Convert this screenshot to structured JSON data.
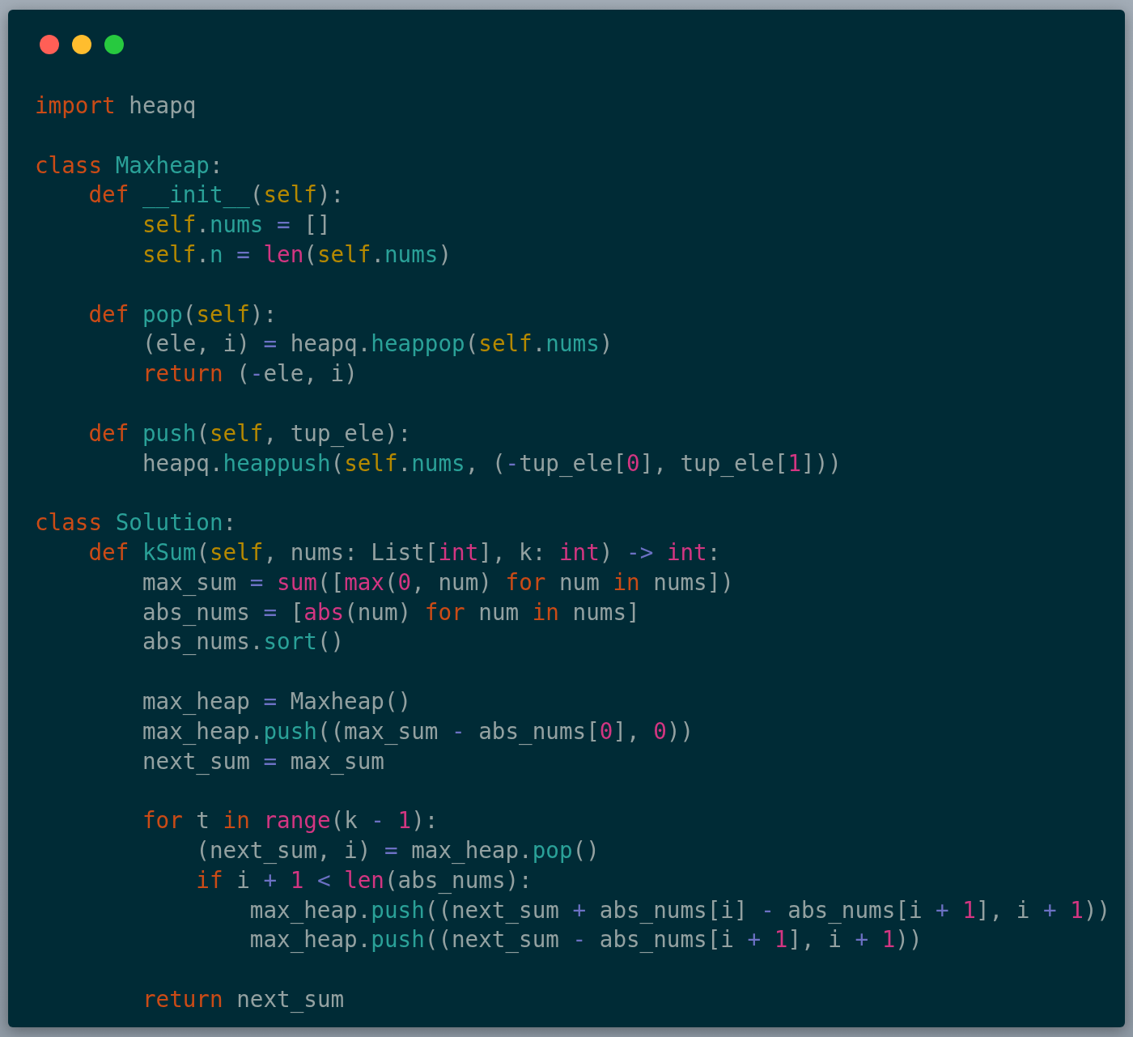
{
  "code_blocks": [
    [
      [
        {
          "kind": "keyword",
          "text": "import"
        },
        {
          "kind": "plain",
          "text": " heapq"
        }
      ]
    ],
    [
      [
        {
          "kind": "keyword",
          "text": "class"
        },
        {
          "kind": "name",
          "text": " Maxheap"
        },
        {
          "kind": "plain",
          "text": ":"
        }
      ],
      [
        {
          "kind": "keyword",
          "text": "    def"
        },
        {
          "kind": "name",
          "text": " __init__"
        },
        {
          "kind": "plain",
          "text": "("
        },
        {
          "kind": "self",
          "text": "self"
        },
        {
          "kind": "plain",
          "text": "):"
        }
      ],
      [
        {
          "kind": "self",
          "text": "        self"
        },
        {
          "kind": "plain",
          "text": "."
        },
        {
          "kind": "name",
          "text": "nums"
        },
        {
          "kind": "operator",
          "text": " ="
        },
        {
          "kind": "plain",
          "text": " []"
        }
      ],
      [
        {
          "kind": "self",
          "text": "        self"
        },
        {
          "kind": "plain",
          "text": "."
        },
        {
          "kind": "name",
          "text": "n"
        },
        {
          "kind": "operator",
          "text": " ="
        },
        {
          "kind": "builtin",
          "text": " len"
        },
        {
          "kind": "plain",
          "text": "("
        },
        {
          "kind": "self",
          "text": "self"
        },
        {
          "kind": "plain",
          "text": "."
        },
        {
          "kind": "name",
          "text": "nums"
        },
        {
          "kind": "plain",
          "text": ")"
        }
      ]
    ],
    [
      [
        {
          "kind": "keyword",
          "text": "    def"
        },
        {
          "kind": "name",
          "text": " pop"
        },
        {
          "kind": "plain",
          "text": "("
        },
        {
          "kind": "self",
          "text": "self"
        },
        {
          "kind": "plain",
          "text": "):"
        }
      ],
      [
        {
          "kind": "plain",
          "text": "        (ele, i) "
        },
        {
          "kind": "operator",
          "text": "="
        },
        {
          "kind": "plain",
          "text": " heapq."
        },
        {
          "kind": "name",
          "text": "heappop"
        },
        {
          "kind": "plain",
          "text": "("
        },
        {
          "kind": "self",
          "text": "self"
        },
        {
          "kind": "plain",
          "text": "."
        },
        {
          "kind": "name",
          "text": "nums"
        },
        {
          "kind": "plain",
          "text": ")"
        }
      ],
      [
        {
          "kind": "keyword",
          "text": "        return"
        },
        {
          "kind": "plain",
          "text": " ("
        },
        {
          "kind": "operator",
          "text": "-"
        },
        {
          "kind": "plain",
          "text": "ele, i)"
        }
      ]
    ],
    [
      [
        {
          "kind": "keyword",
          "text": "    def"
        },
        {
          "kind": "name",
          "text": " push"
        },
        {
          "kind": "plain",
          "text": "("
        },
        {
          "kind": "self",
          "text": "self"
        },
        {
          "kind": "plain",
          "text": ", tup_ele):"
        }
      ],
      [
        {
          "kind": "plain",
          "text": "        heapq."
        },
        {
          "kind": "name",
          "text": "heappush"
        },
        {
          "kind": "plain",
          "text": "("
        },
        {
          "kind": "self",
          "text": "self"
        },
        {
          "kind": "plain",
          "text": "."
        },
        {
          "kind": "name",
          "text": "nums"
        },
        {
          "kind": "plain",
          "text": ", ("
        },
        {
          "kind": "operator",
          "text": "-"
        },
        {
          "kind": "plain",
          "text": "tup_ele["
        },
        {
          "kind": "number",
          "text": "0"
        },
        {
          "kind": "plain",
          "text": "], tup_ele["
        },
        {
          "kind": "number",
          "text": "1"
        },
        {
          "kind": "plain",
          "text": "]))"
        }
      ]
    ],
    [
      [
        {
          "kind": "keyword",
          "text": "class"
        },
        {
          "kind": "name",
          "text": " Solution"
        },
        {
          "kind": "plain",
          "text": ":"
        }
      ],
      [
        {
          "kind": "keyword",
          "text": "    def"
        },
        {
          "kind": "name",
          "text": " kSum"
        },
        {
          "kind": "plain",
          "text": "("
        },
        {
          "kind": "self",
          "text": "self"
        },
        {
          "kind": "plain",
          "text": ", nums: List["
        },
        {
          "kind": "builtin",
          "text": "int"
        },
        {
          "kind": "plain",
          "text": "], k: "
        },
        {
          "kind": "builtin",
          "text": "int"
        },
        {
          "kind": "plain",
          "text": ") "
        },
        {
          "kind": "operator",
          "text": "->"
        },
        {
          "kind": "builtin",
          "text": " int"
        },
        {
          "kind": "plain",
          "text": ":"
        }
      ],
      [
        {
          "kind": "plain",
          "text": "        max_sum "
        },
        {
          "kind": "operator",
          "text": "="
        },
        {
          "kind": "builtin",
          "text": " sum"
        },
        {
          "kind": "plain",
          "text": "(["
        },
        {
          "kind": "builtin",
          "text": "max"
        },
        {
          "kind": "plain",
          "text": "("
        },
        {
          "kind": "number",
          "text": "0"
        },
        {
          "kind": "plain",
          "text": ", num) "
        },
        {
          "kind": "keyword",
          "text": "for"
        },
        {
          "kind": "plain",
          "text": " num "
        },
        {
          "kind": "keyword",
          "text": "in"
        },
        {
          "kind": "plain",
          "text": " nums])"
        }
      ],
      [
        {
          "kind": "plain",
          "text": "        abs_nums "
        },
        {
          "kind": "operator",
          "text": "="
        },
        {
          "kind": "plain",
          "text": " ["
        },
        {
          "kind": "builtin",
          "text": "abs"
        },
        {
          "kind": "plain",
          "text": "(num) "
        },
        {
          "kind": "keyword",
          "text": "for"
        },
        {
          "kind": "plain",
          "text": " num "
        },
        {
          "kind": "keyword",
          "text": "in"
        },
        {
          "kind": "plain",
          "text": " nums]"
        }
      ],
      [
        {
          "kind": "plain",
          "text": "        abs_nums."
        },
        {
          "kind": "name",
          "text": "sort"
        },
        {
          "kind": "plain",
          "text": "()"
        }
      ]
    ],
    [
      [
        {
          "kind": "plain",
          "text": "        max_heap "
        },
        {
          "kind": "operator",
          "text": "="
        },
        {
          "kind": "plain",
          "text": " Maxheap()"
        }
      ],
      [
        {
          "kind": "plain",
          "text": "        max_heap."
        },
        {
          "kind": "name",
          "text": "push"
        },
        {
          "kind": "plain",
          "text": "((max_sum "
        },
        {
          "kind": "operator",
          "text": "-"
        },
        {
          "kind": "plain",
          "text": " abs_nums["
        },
        {
          "kind": "number",
          "text": "0"
        },
        {
          "kind": "plain",
          "text": "], "
        },
        {
          "kind": "number",
          "text": "0"
        },
        {
          "kind": "plain",
          "text": "))"
        }
      ],
      [
        {
          "kind": "plain",
          "text": "        next_sum "
        },
        {
          "kind": "operator",
          "text": "="
        },
        {
          "kind": "plain",
          "text": " max_sum"
        }
      ]
    ],
    [
      [
        {
          "kind": "keyword",
          "text": "        for"
        },
        {
          "kind": "plain",
          "text": " t "
        },
        {
          "kind": "keyword",
          "text": "in"
        },
        {
          "kind": "builtin",
          "text": " range"
        },
        {
          "kind": "plain",
          "text": "(k "
        },
        {
          "kind": "operator",
          "text": "-"
        },
        {
          "kind": "number",
          "text": " 1"
        },
        {
          "kind": "plain",
          "text": "):"
        }
      ],
      [
        {
          "kind": "plain",
          "text": "            (next_sum, i) "
        },
        {
          "kind": "operator",
          "text": "="
        },
        {
          "kind": "plain",
          "text": " max_heap."
        },
        {
          "kind": "name",
          "text": "pop"
        },
        {
          "kind": "plain",
          "text": "()"
        }
      ],
      [
        {
          "kind": "keyword",
          "text": "            if"
        },
        {
          "kind": "plain",
          "text": " i "
        },
        {
          "kind": "operator",
          "text": "+"
        },
        {
          "kind": "number",
          "text": " 1"
        },
        {
          "kind": "operator",
          "text": " <"
        },
        {
          "kind": "builtin",
          "text": " len"
        },
        {
          "kind": "plain",
          "text": "(abs_nums):"
        }
      ],
      [
        {
          "kind": "plain",
          "text": "                max_heap."
        },
        {
          "kind": "name",
          "text": "push"
        },
        {
          "kind": "plain",
          "text": "((next_sum "
        },
        {
          "kind": "operator",
          "text": "+"
        },
        {
          "kind": "plain",
          "text": " abs_nums[i] "
        },
        {
          "kind": "operator",
          "text": "-"
        },
        {
          "kind": "plain",
          "text": " abs_nums[i "
        },
        {
          "kind": "operator",
          "text": "+"
        },
        {
          "kind": "number",
          "text": " 1"
        },
        {
          "kind": "plain",
          "text": "], i "
        },
        {
          "kind": "operator",
          "text": "+"
        },
        {
          "kind": "number",
          "text": " 1"
        },
        {
          "kind": "plain",
          "text": "))"
        }
      ],
      [
        {
          "kind": "plain",
          "text": "                max_heap."
        },
        {
          "kind": "name",
          "text": "push"
        },
        {
          "kind": "plain",
          "text": "((next_sum "
        },
        {
          "kind": "operator",
          "text": "-"
        },
        {
          "kind": "plain",
          "text": " abs_nums[i "
        },
        {
          "kind": "operator",
          "text": "+"
        },
        {
          "kind": "number",
          "text": " 1"
        },
        {
          "kind": "plain",
          "text": "], i "
        },
        {
          "kind": "operator",
          "text": "+"
        },
        {
          "kind": "number",
          "text": " 1"
        },
        {
          "kind": "plain",
          "text": "))"
        }
      ]
    ],
    [
      [
        {
          "kind": "keyword",
          "text": "        return"
        },
        {
          "kind": "plain",
          "text": " next_sum"
        }
      ]
    ]
  ]
}
